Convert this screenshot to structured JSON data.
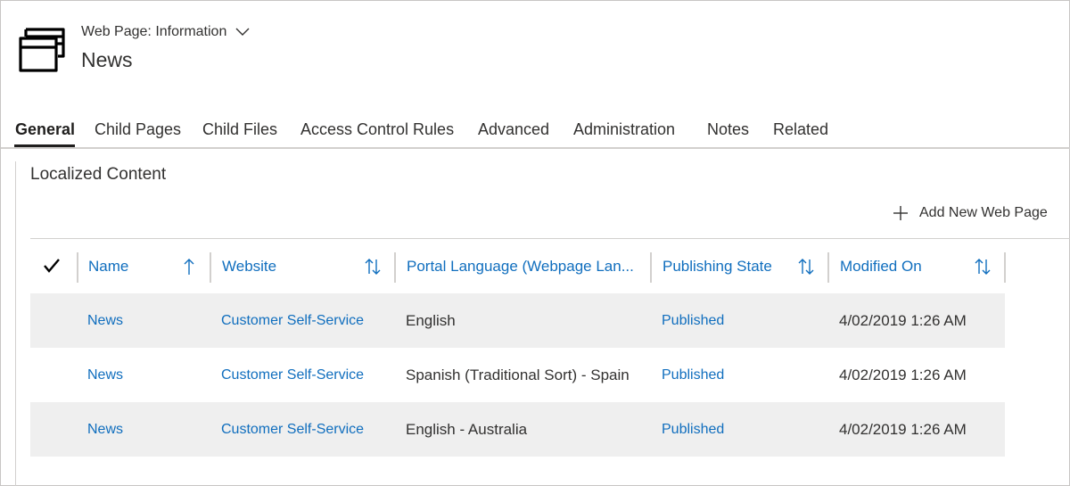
{
  "header": {
    "entity_type": "Web Page: Information",
    "record_title": "News",
    "icon": "web-page-stack-icon"
  },
  "tabs": [
    {
      "label": "General",
      "active": true
    },
    {
      "label": "Child Pages"
    },
    {
      "label": "Child Files"
    },
    {
      "label": "Access Control Rules"
    },
    {
      "label": "Advanced"
    },
    {
      "label": "Administration"
    },
    {
      "label": "Notes"
    },
    {
      "label": "Related"
    }
  ],
  "section": {
    "title": "Localized Content",
    "add_button_label": "Add New Web Page"
  },
  "grid": {
    "columns": [
      {
        "label": "Name",
        "sort": "ascending"
      },
      {
        "label": "Website",
        "sort": "sortable"
      },
      {
        "label": "Portal Language (Webpage Lan...",
        "sort": "none"
      },
      {
        "label": "Publishing State",
        "sort": "sortable"
      },
      {
        "label": "Modified On",
        "sort": "sortable"
      }
    ],
    "rows": [
      {
        "name": "News",
        "website": "Customer Self-Service",
        "language": "English",
        "state": "Published",
        "modified": "4/02/2019 1:26 AM"
      },
      {
        "name": "News",
        "website": "Customer Self-Service",
        "language": "Spanish (Traditional Sort) - Spain",
        "state": "Published",
        "modified": "4/02/2019 1:26 AM"
      },
      {
        "name": "News",
        "website": "Customer Self-Service",
        "language": "English - Australia",
        "state": "Published",
        "modified": "4/02/2019 1:26 AM"
      }
    ]
  },
  "colors": {
    "link": "#106ebe",
    "text": "#323130",
    "row_alt": "#efefef",
    "border": "#d2d0ce"
  }
}
